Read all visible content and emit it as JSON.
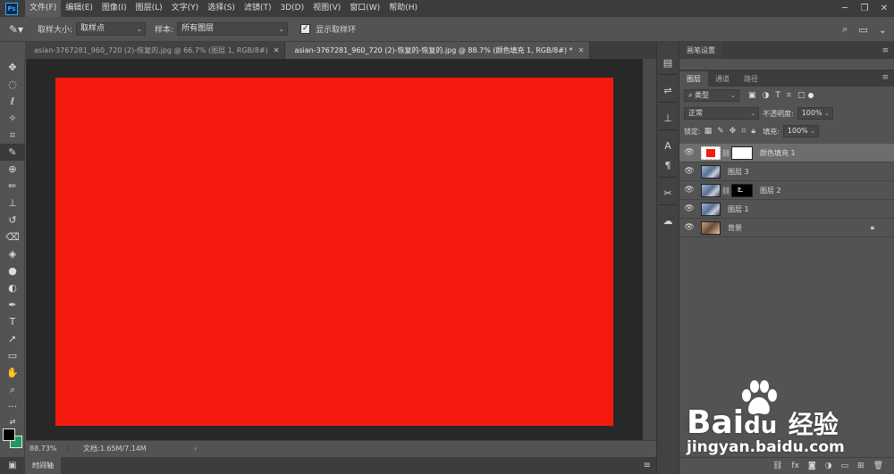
{
  "app": {
    "logo": "Ps"
  },
  "menu": [
    "文件(F)",
    "编辑(E)",
    "图像(I)",
    "图层(L)",
    "文字(Y)",
    "选择(S)",
    "滤镜(T)",
    "3D(D)",
    "视图(V)",
    "窗口(W)",
    "帮助(H)"
  ],
  "options": {
    "sample_size_label": "取样大小:",
    "sample_size_value": "取样点",
    "sample_label": "样本:",
    "sample_value": "所有图层",
    "show_ring_label": "显示取样环"
  },
  "tabs": [
    {
      "label": "asian-3767281_960_720 (2)-恢复的.jpg @ 66.7% (图层 1, RGB/8#)",
      "active": false
    },
    {
      "label": "asian-3767281_960_720 (2)-恢复的-恢复的.jpg @ 88.7% (颜色填充 1, RGB/8#) *",
      "active": true
    }
  ],
  "status": {
    "zoom": "88.73%",
    "doc": "文档:1.65M/7.14M"
  },
  "timeline": {
    "label": "时间轴"
  },
  "brush_panel": {
    "title": "画笔设置"
  },
  "layers_panel": {
    "tabs": [
      "图层",
      "通道",
      "路径"
    ],
    "filter_value": "类型",
    "blend_mode": "正常",
    "opacity_label": "不透明度:",
    "opacity_value": "100%",
    "lock_label": "锁定:",
    "fill_label": "填充:",
    "fill_value": "100%",
    "layers": [
      {
        "name": "颜色填充 1",
        "selected": true
      },
      {
        "name": "图层 3",
        "selected": false
      },
      {
        "name": "图层 2",
        "selected": false
      },
      {
        "name": "图层 1",
        "selected": false
      },
      {
        "name": "背景",
        "selected": false
      }
    ]
  },
  "colors": {
    "document_fill": "#f41b0e",
    "background_swatch": "#1f9a5e",
    "foreground_swatch": "#000000"
  },
  "watermark": {
    "brand": "Bai",
    "brand2": "du",
    "brand3": "经验",
    "url": "jingyan.baidu.com"
  }
}
